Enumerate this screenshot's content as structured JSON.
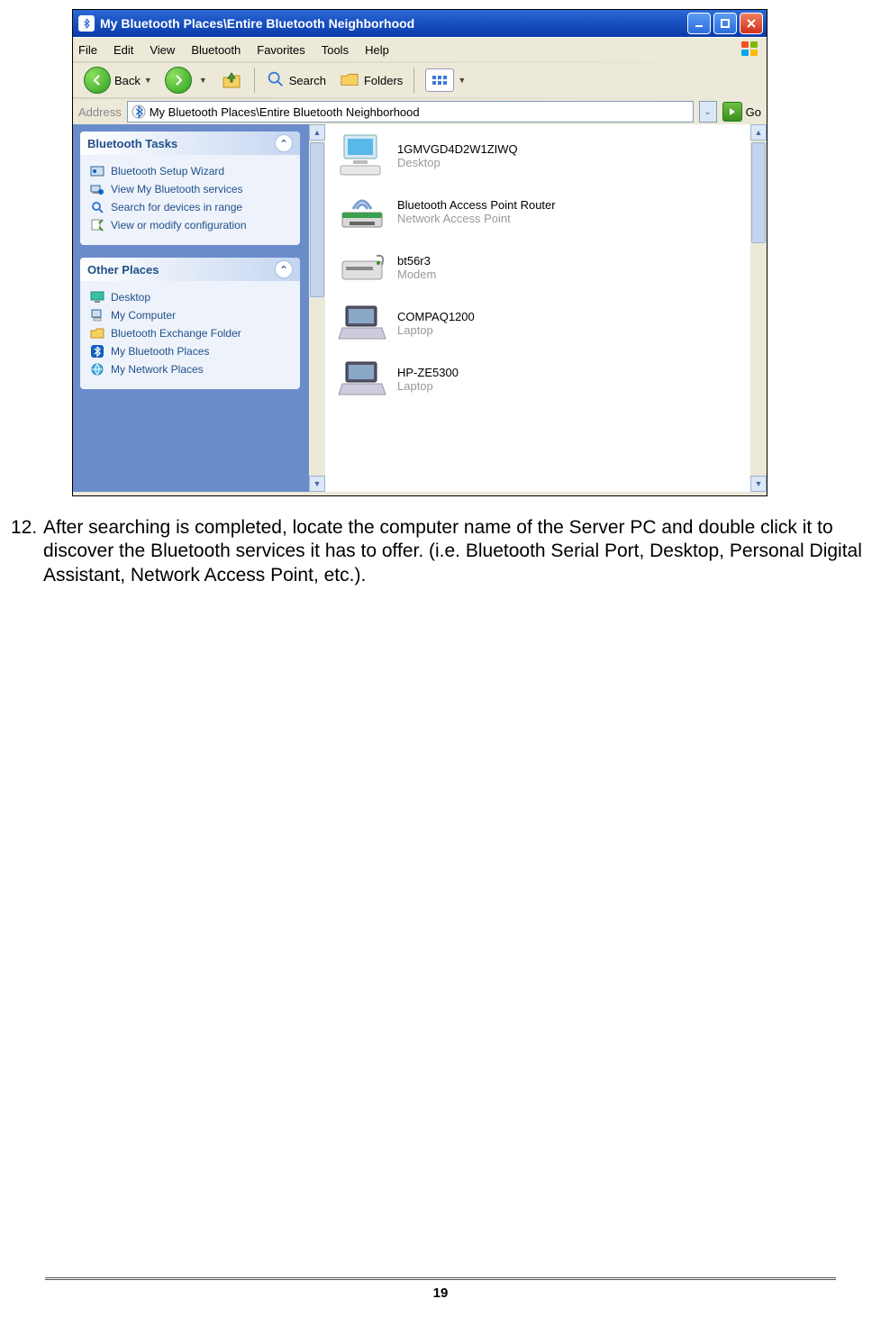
{
  "window": {
    "title": "My Bluetooth Places\\Entire Bluetooth Neighborhood"
  },
  "menu": {
    "items": [
      "File",
      "Edit",
      "View",
      "Bluetooth",
      "Favorites",
      "Tools",
      "Help"
    ]
  },
  "toolbar": {
    "back": "Back",
    "search": "Search",
    "folders": "Folders"
  },
  "address": {
    "label": "Address",
    "value": "My Bluetooth Places\\Entire Bluetooth Neighborhood",
    "go": "Go"
  },
  "sidebar": {
    "panels": [
      {
        "title": "Bluetooth Tasks",
        "items": [
          {
            "icon": "wizard",
            "label": "Bluetooth Setup Wizard"
          },
          {
            "icon": "services",
            "label": "View My Bluetooth services"
          },
          {
            "icon": "search",
            "label": "Search for devices in range"
          },
          {
            "icon": "config",
            "label": "View or modify configuration"
          }
        ]
      },
      {
        "title": "Other Places",
        "items": [
          {
            "icon": "desktop",
            "label": "Desktop"
          },
          {
            "icon": "mycomputer",
            "label": "My Computer"
          },
          {
            "icon": "folder",
            "label": "Bluetooth Exchange Folder"
          },
          {
            "icon": "btplaces",
            "label": "My Bluetooth Places"
          },
          {
            "icon": "network",
            "label": "My Network Places"
          }
        ]
      }
    ]
  },
  "devices": [
    {
      "icon": "desktop",
      "name": "1GMVGD4D2W1ZIWQ",
      "type": "Desktop"
    },
    {
      "icon": "ap",
      "name": "Bluetooth Access Point Router",
      "type": "Network Access Point"
    },
    {
      "icon": "modem",
      "name": "bt56r3",
      "type": "Modem"
    },
    {
      "icon": "laptop",
      "name": "COMPAQ1200",
      "type": "Laptop"
    },
    {
      "icon": "laptop",
      "name": "HP-ZE5300",
      "type": "Laptop"
    }
  ],
  "instruction": {
    "number": "12.",
    "text": "After searching is completed, locate the computer name of the Server PC and double click it to discover the Bluetooth services it has to offer. (i.e. Bluetooth Serial Port, Desktop, Personal Digital Assistant, Network Access Point, etc.)."
  },
  "page_number": "19"
}
